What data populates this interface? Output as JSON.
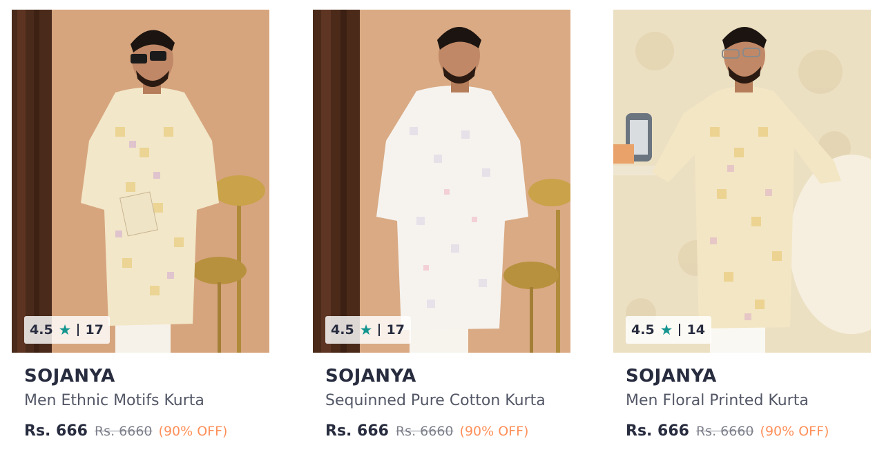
{
  "accent_colors": {
    "star": "#14958f",
    "discount": "#ff905a",
    "brand_text": "#282c3f"
  },
  "products": [
    {
      "image_alt": "Man wearing cream ethnic motif kurta with sunglasses",
      "rating": "4.5",
      "star_icon": "star-icon",
      "review_count": "17",
      "brand": "SOJANYA",
      "title": "Men Ethnic Motifs Kurta",
      "price": "Rs. 666",
      "mrp": "Rs. 6660",
      "discount": "(90% OFF)"
    },
    {
      "image_alt": "Man wearing white sequinned pure cotton kurta",
      "rating": "4.5",
      "star_icon": "star-icon",
      "review_count": "17",
      "brand": "SOJANYA",
      "title": "Sequinned Pure Cotton Kurta",
      "price": "Rs. 666",
      "mrp": "Rs. 6660",
      "discount": "(90% OFF)"
    },
    {
      "image_alt": "Man wearing cream floral printed kurta",
      "rating": "4.5",
      "star_icon": "star-icon",
      "review_count": "14",
      "brand": "SOJANYA",
      "title": "Men Floral Printed Kurta",
      "price": "Rs. 666",
      "mrp": "Rs. 6660",
      "discount": "(90% OFF)"
    }
  ]
}
